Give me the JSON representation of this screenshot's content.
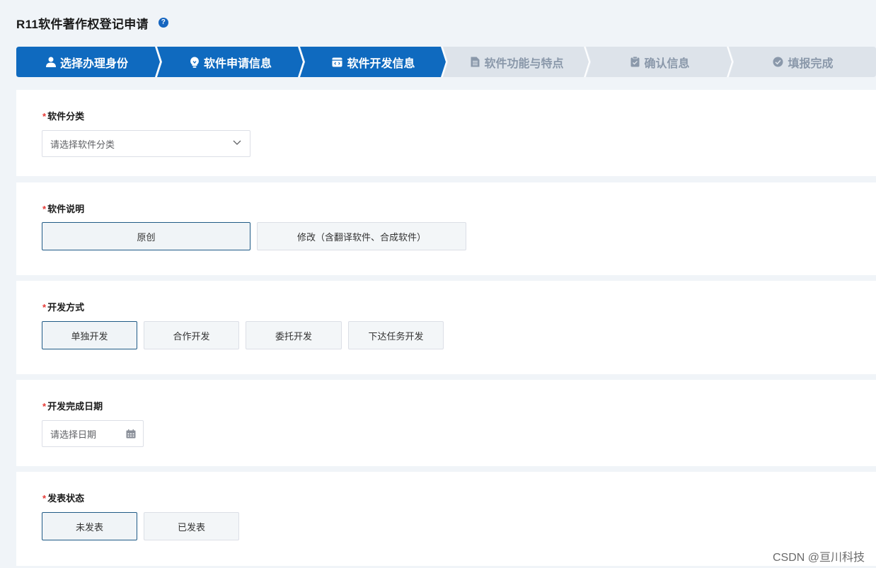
{
  "header": {
    "title": "R11软件著作权登记申请",
    "help_icon_text": "?"
  },
  "stepper": {
    "active_color": "#0f6abf",
    "inactive_color": "#dde3ea",
    "steps": [
      {
        "label": "选择办理身份",
        "icon": "user-icon",
        "state": "done"
      },
      {
        "label": "软件申请信息",
        "icon": "lightbulb-icon",
        "state": "done"
      },
      {
        "label": "软件开发信息",
        "icon": "code-window-icon",
        "state": "current"
      },
      {
        "label": "软件功能与特点",
        "icon": "document-icon",
        "state": "pending"
      },
      {
        "label": "确认信息",
        "icon": "clipboard-check-icon",
        "state": "pending"
      },
      {
        "label": "填报完成",
        "icon": "check-circle-icon",
        "state": "pending"
      }
    ]
  },
  "form": {
    "required_mark": "*",
    "category": {
      "label": "软件分类",
      "placeholder": "请选择软件分类"
    },
    "description": {
      "label": "软件说明",
      "options": [
        "原创",
        "修改（含翻译软件、合成软件）"
      ],
      "selected": "原创"
    },
    "dev_method": {
      "label": "开发方式",
      "options": [
        "单独开发",
        "合作开发",
        "委托开发",
        "下达任务开发"
      ],
      "selected": "单独开发"
    },
    "completion_date": {
      "label": "开发完成日期",
      "placeholder": "请选择日期"
    },
    "publish_status": {
      "label": "发表状态",
      "options": [
        "未发表",
        "已发表"
      ],
      "selected": "未发表"
    }
  },
  "watermark": "CSDN @亘川科技"
}
